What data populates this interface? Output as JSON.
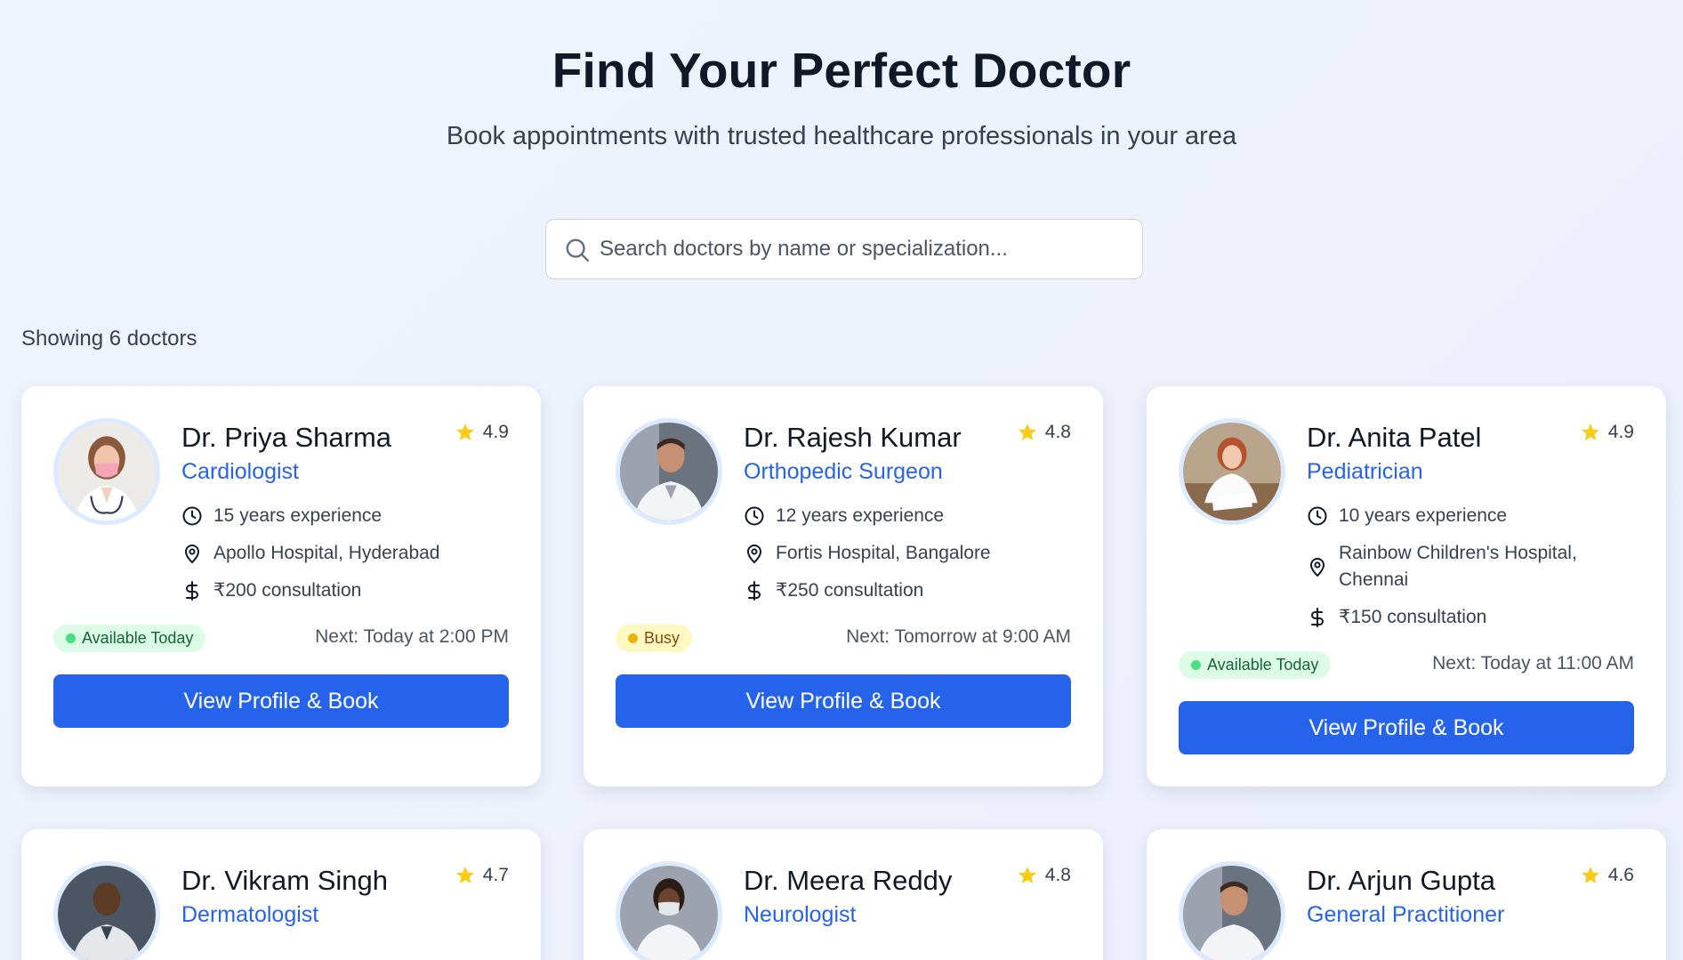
{
  "header": {
    "title": "Find Your Perfect Doctor",
    "subtitle": "Book appointments with trusted healthcare professionals in your area"
  },
  "search": {
    "placeholder": "Search doctors by name or specialization...",
    "value": "",
    "icon": "search-icon"
  },
  "results": {
    "count_text": "Showing 6 doctors"
  },
  "colors": {
    "accent": "#2563eb",
    "star": "#facc15",
    "available_bg": "#dcfce7",
    "busy_bg": "#fef9c3"
  },
  "doctors": [
    {
      "name": "Dr. Priya Sharma",
      "specialization": "Cardiologist",
      "rating": "4.9",
      "experience": "15 years experience",
      "location": "Apollo Hospital, Hyderabad",
      "fee": "₹200 consultation",
      "status": "Available Today",
      "next": "Next: Today at 2:00 PM",
      "button": "View Profile & Book"
    },
    {
      "name": "Dr. Rajesh Kumar",
      "specialization": "Orthopedic Surgeon",
      "rating": "4.8",
      "experience": "12 years experience",
      "location": "Fortis Hospital, Bangalore",
      "fee": "₹250 consultation",
      "status": "Busy",
      "next": "Next: Tomorrow at 9:00 AM",
      "button": "View Profile & Book"
    },
    {
      "name": "Dr. Anita Patel",
      "specialization": "Pediatrician",
      "rating": "4.9",
      "experience": "10 years experience",
      "location": "Rainbow Children's Hospital, Chennai",
      "fee": "₹150 consultation",
      "status": "Available Today",
      "next": "Next: Today at 11:00 AM",
      "button": "View Profile & Book"
    },
    {
      "name": "Dr. Vikram Singh",
      "specialization": "Dermatologist",
      "rating": "4.7"
    },
    {
      "name": "Dr. Meera Reddy",
      "specialization": "Neurologist",
      "rating": "4.8"
    },
    {
      "name": "Dr. Arjun Gupta",
      "specialization": "General Practitioner",
      "rating": "4.6"
    }
  ]
}
